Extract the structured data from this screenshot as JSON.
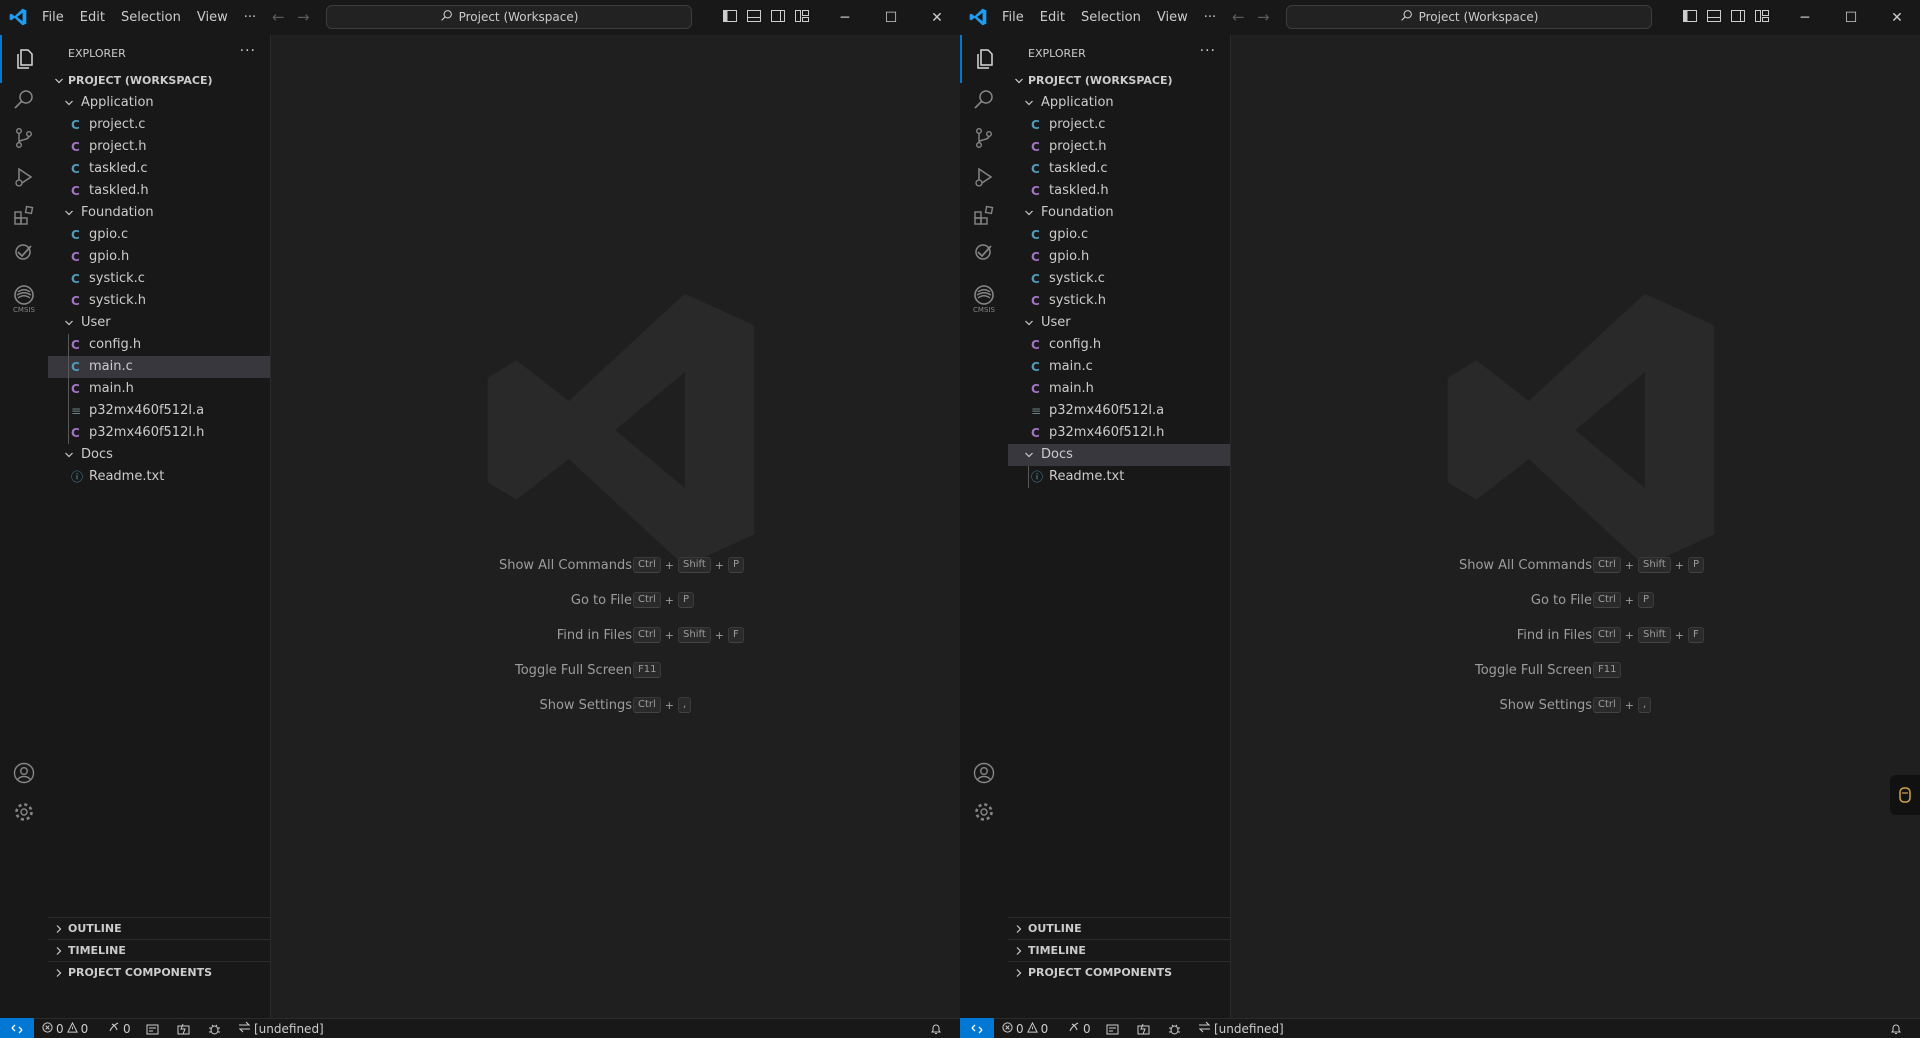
{
  "windows": [
    {
      "id": "left",
      "titlebar": {
        "menu": [
          "File",
          "Edit",
          "Selection",
          "View"
        ],
        "more": "···",
        "search_label": "Project (Workspace)"
      },
      "explorer": {
        "title": "EXPLORER",
        "more": "···",
        "root": "PROJECT (WORKSPACE)",
        "selected": "User/main.c",
        "folders": [
          {
            "name": "Application",
            "files": [
              {
                "name": "project.c",
                "icon": "C",
                "type": "c"
              },
              {
                "name": "project.h",
                "icon": "C",
                "type": "h"
              },
              {
                "name": "taskled.c",
                "icon": "C",
                "type": "c"
              },
              {
                "name": "taskled.h",
                "icon": "C",
                "type": "h"
              }
            ]
          },
          {
            "name": "Foundation",
            "files": [
              {
                "name": "gpio.c",
                "icon": "C",
                "type": "c"
              },
              {
                "name": "gpio.h",
                "icon": "C",
                "type": "h"
              },
              {
                "name": "systick.c",
                "icon": "C",
                "type": "c"
              },
              {
                "name": "systick.h",
                "icon": "C",
                "type": "h"
              }
            ]
          },
          {
            "name": "User",
            "files": [
              {
                "name": "config.h",
                "icon": "C",
                "type": "h"
              },
              {
                "name": "main.c",
                "icon": "C",
                "type": "c"
              },
              {
                "name": "main.h",
                "icon": "C",
                "type": "h"
              },
              {
                "name": "p32mx460f512l.a",
                "icon": "≡",
                "type": "txt"
              },
              {
                "name": "p32mx460f512l.h",
                "icon": "C",
                "type": "h"
              }
            ]
          },
          {
            "name": "Docs",
            "files": [
              {
                "name": "Readme.txt",
                "icon": "ⓘ",
                "type": "info"
              }
            ]
          }
        ],
        "panels": [
          "OUTLINE",
          "TIMELINE",
          "PROJECT COMPONENTS"
        ]
      },
      "activity": {
        "cmsis_label": "CMSIS"
      },
      "shortcuts": [
        {
          "label": "Show All Commands",
          "keys": [
            "Ctrl",
            "Shift",
            "P"
          ]
        },
        {
          "label": "Go to File",
          "keys": [
            "Ctrl",
            "P"
          ]
        },
        {
          "label": "Find in Files",
          "keys": [
            "Ctrl",
            "Shift",
            "F"
          ]
        },
        {
          "label": "Toggle Full Screen",
          "keys": [
            "F11"
          ]
        },
        {
          "label": "Show Settings",
          "keys": [
            "Ctrl",
            ","
          ]
        }
      ],
      "status": {
        "errors": "0",
        "warnings": "0",
        "ports": "0",
        "target": "[undefined]"
      }
    },
    {
      "id": "right",
      "titlebar": {
        "menu": [
          "File",
          "Edit",
          "Selection",
          "View"
        ],
        "more": "···",
        "search_label": "Project (Workspace)"
      },
      "explorer": {
        "title": "EXPLORER",
        "more": "···",
        "root": "PROJECT (WORKSPACE)",
        "selected": "Docs",
        "folders": [
          {
            "name": "Application",
            "files": [
              {
                "name": "project.c",
                "icon": "C",
                "type": "c"
              },
              {
                "name": "project.h",
                "icon": "C",
                "type": "h"
              },
              {
                "name": "taskled.c",
                "icon": "C",
                "type": "c"
              },
              {
                "name": "taskled.h",
                "icon": "C",
                "type": "h"
              }
            ]
          },
          {
            "name": "Foundation",
            "files": [
              {
                "name": "gpio.c",
                "icon": "C",
                "type": "c"
              },
              {
                "name": "gpio.h",
                "icon": "C",
                "type": "h"
              },
              {
                "name": "systick.c",
                "icon": "C",
                "type": "c"
              },
              {
                "name": "systick.h",
                "icon": "C",
                "type": "h"
              }
            ]
          },
          {
            "name": "User",
            "files": [
              {
                "name": "config.h",
                "icon": "C",
                "type": "h"
              },
              {
                "name": "main.c",
                "icon": "C",
                "type": "c"
              },
              {
                "name": "main.h",
                "icon": "C",
                "type": "h"
              },
              {
                "name": "p32mx460f512l.a",
                "icon": "≡",
                "type": "txt"
              },
              {
                "name": "p32mx460f512l.h",
                "icon": "C",
                "type": "h"
              }
            ]
          },
          {
            "name": "Docs",
            "files": [
              {
                "name": "Readme.txt",
                "icon": "ⓘ",
                "type": "info"
              }
            ]
          }
        ],
        "panels": [
          "OUTLINE",
          "TIMELINE",
          "PROJECT COMPONENTS"
        ]
      },
      "activity": {
        "cmsis_label": "CMSIS"
      },
      "shortcuts": [
        {
          "label": "Show All Commands",
          "keys": [
            "Ctrl",
            "Shift",
            "P"
          ]
        },
        {
          "label": "Go to File",
          "keys": [
            "Ctrl",
            "P"
          ]
        },
        {
          "label": "Find in Files",
          "keys": [
            "Ctrl",
            "Shift",
            "F"
          ]
        },
        {
          "label": "Toggle Full Screen",
          "keys": [
            "F11"
          ]
        },
        {
          "label": "Show Settings",
          "keys": [
            "Ctrl",
            ","
          ]
        }
      ],
      "status": {
        "errors": "0",
        "warnings": "0",
        "ports": "0",
        "target": "[undefined]"
      }
    }
  ],
  "icons": {
    "titlebar": [
      "vscode-logo-icon",
      "back-arrow-icon",
      "forward-arrow-icon",
      "search-icon",
      "toggle-primary-sidebar-icon",
      "toggle-panel-icon",
      "toggle-secondary-sidebar-icon",
      "customize-layout-icon",
      "minimize-icon",
      "maximize-icon",
      "close-icon"
    ],
    "activity": [
      "explorer-icon",
      "search-icon",
      "source-control-icon",
      "run-debug-icon",
      "extensions-icon",
      "cmsis-icon",
      "arm-tools-icon",
      "account-icon",
      "settings-gear-icon"
    ],
    "status": [
      "remote-icon",
      "error-icon",
      "warning-icon",
      "ports-icon",
      "build-icon",
      "flash-icon",
      "debug-icon",
      "target-swap-icon",
      "bell-icon"
    ]
  },
  "colors": {
    "accent": "#0078d4",
    "c_file": "#519aba",
    "h_file": "#a074c4",
    "selection": "#37373d"
  }
}
